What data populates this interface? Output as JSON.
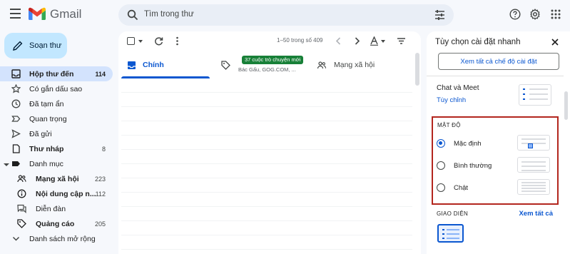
{
  "header": {
    "app_name": "Gmail",
    "search_placeholder": "Tìm trong thư"
  },
  "compose": {
    "label": "Soạn thư"
  },
  "nav": {
    "items": [
      {
        "label": "Hộp thư đến",
        "count": "114",
        "icon": "inbox-icon",
        "active": true
      },
      {
        "label": "Có gắn dấu sao",
        "count": "",
        "icon": "star-icon"
      },
      {
        "label": "Đã tạm ẩn",
        "count": "",
        "icon": "clock-icon"
      },
      {
        "label": "Quan trọng",
        "count": "",
        "icon": "important-icon"
      },
      {
        "label": "Đã gửi",
        "count": "",
        "icon": "send-icon"
      },
      {
        "label": "Thư nháp",
        "count": "8",
        "icon": "draft-icon",
        "bold": true
      }
    ],
    "categories_label": "Danh mục",
    "categories": [
      {
        "label": "Mạng xã hội",
        "count": "223",
        "icon": "people-icon",
        "bold": true
      },
      {
        "label": "Nội dung cập n...",
        "count": "112",
        "icon": "info-icon",
        "bold": true
      },
      {
        "label": "Diễn đàn",
        "count": "",
        "icon": "forum-icon"
      },
      {
        "label": "Quảng cáo",
        "count": "205",
        "icon": "tag-icon",
        "bold": true
      }
    ],
    "more_label": "Danh sách mở rộng"
  },
  "toolbar": {
    "range": "1–50 trong số 409"
  },
  "tabs": {
    "primary": "Chính",
    "promotions_badge": "37 cuộc trò chuyện mới",
    "promotions_senders": "Bác Gấu, GOG.COM, ...",
    "social": "Mạng xã hội"
  },
  "quick_settings": {
    "title": "Tùy chọn cài đặt nhanh",
    "see_all": "Xem tất cả chế độ cài đặt",
    "chat_meet": "Chat và Meet",
    "customize": "Tùy chỉnh",
    "density_title": "MẬT ĐỘ",
    "density_options": [
      "Mặc định",
      "Bình thường",
      "Chật"
    ],
    "density_selected": 0,
    "theme_title": "GIAO DIỆN",
    "theme_see_all": "Xem tất cả"
  },
  "colors": {
    "accent": "#0b57d0",
    "compose_bg": "#c2e7ff",
    "active_nav_bg": "#d3e3fd",
    "highlight_box": "#b3261e",
    "promo_badge": "#188038"
  }
}
